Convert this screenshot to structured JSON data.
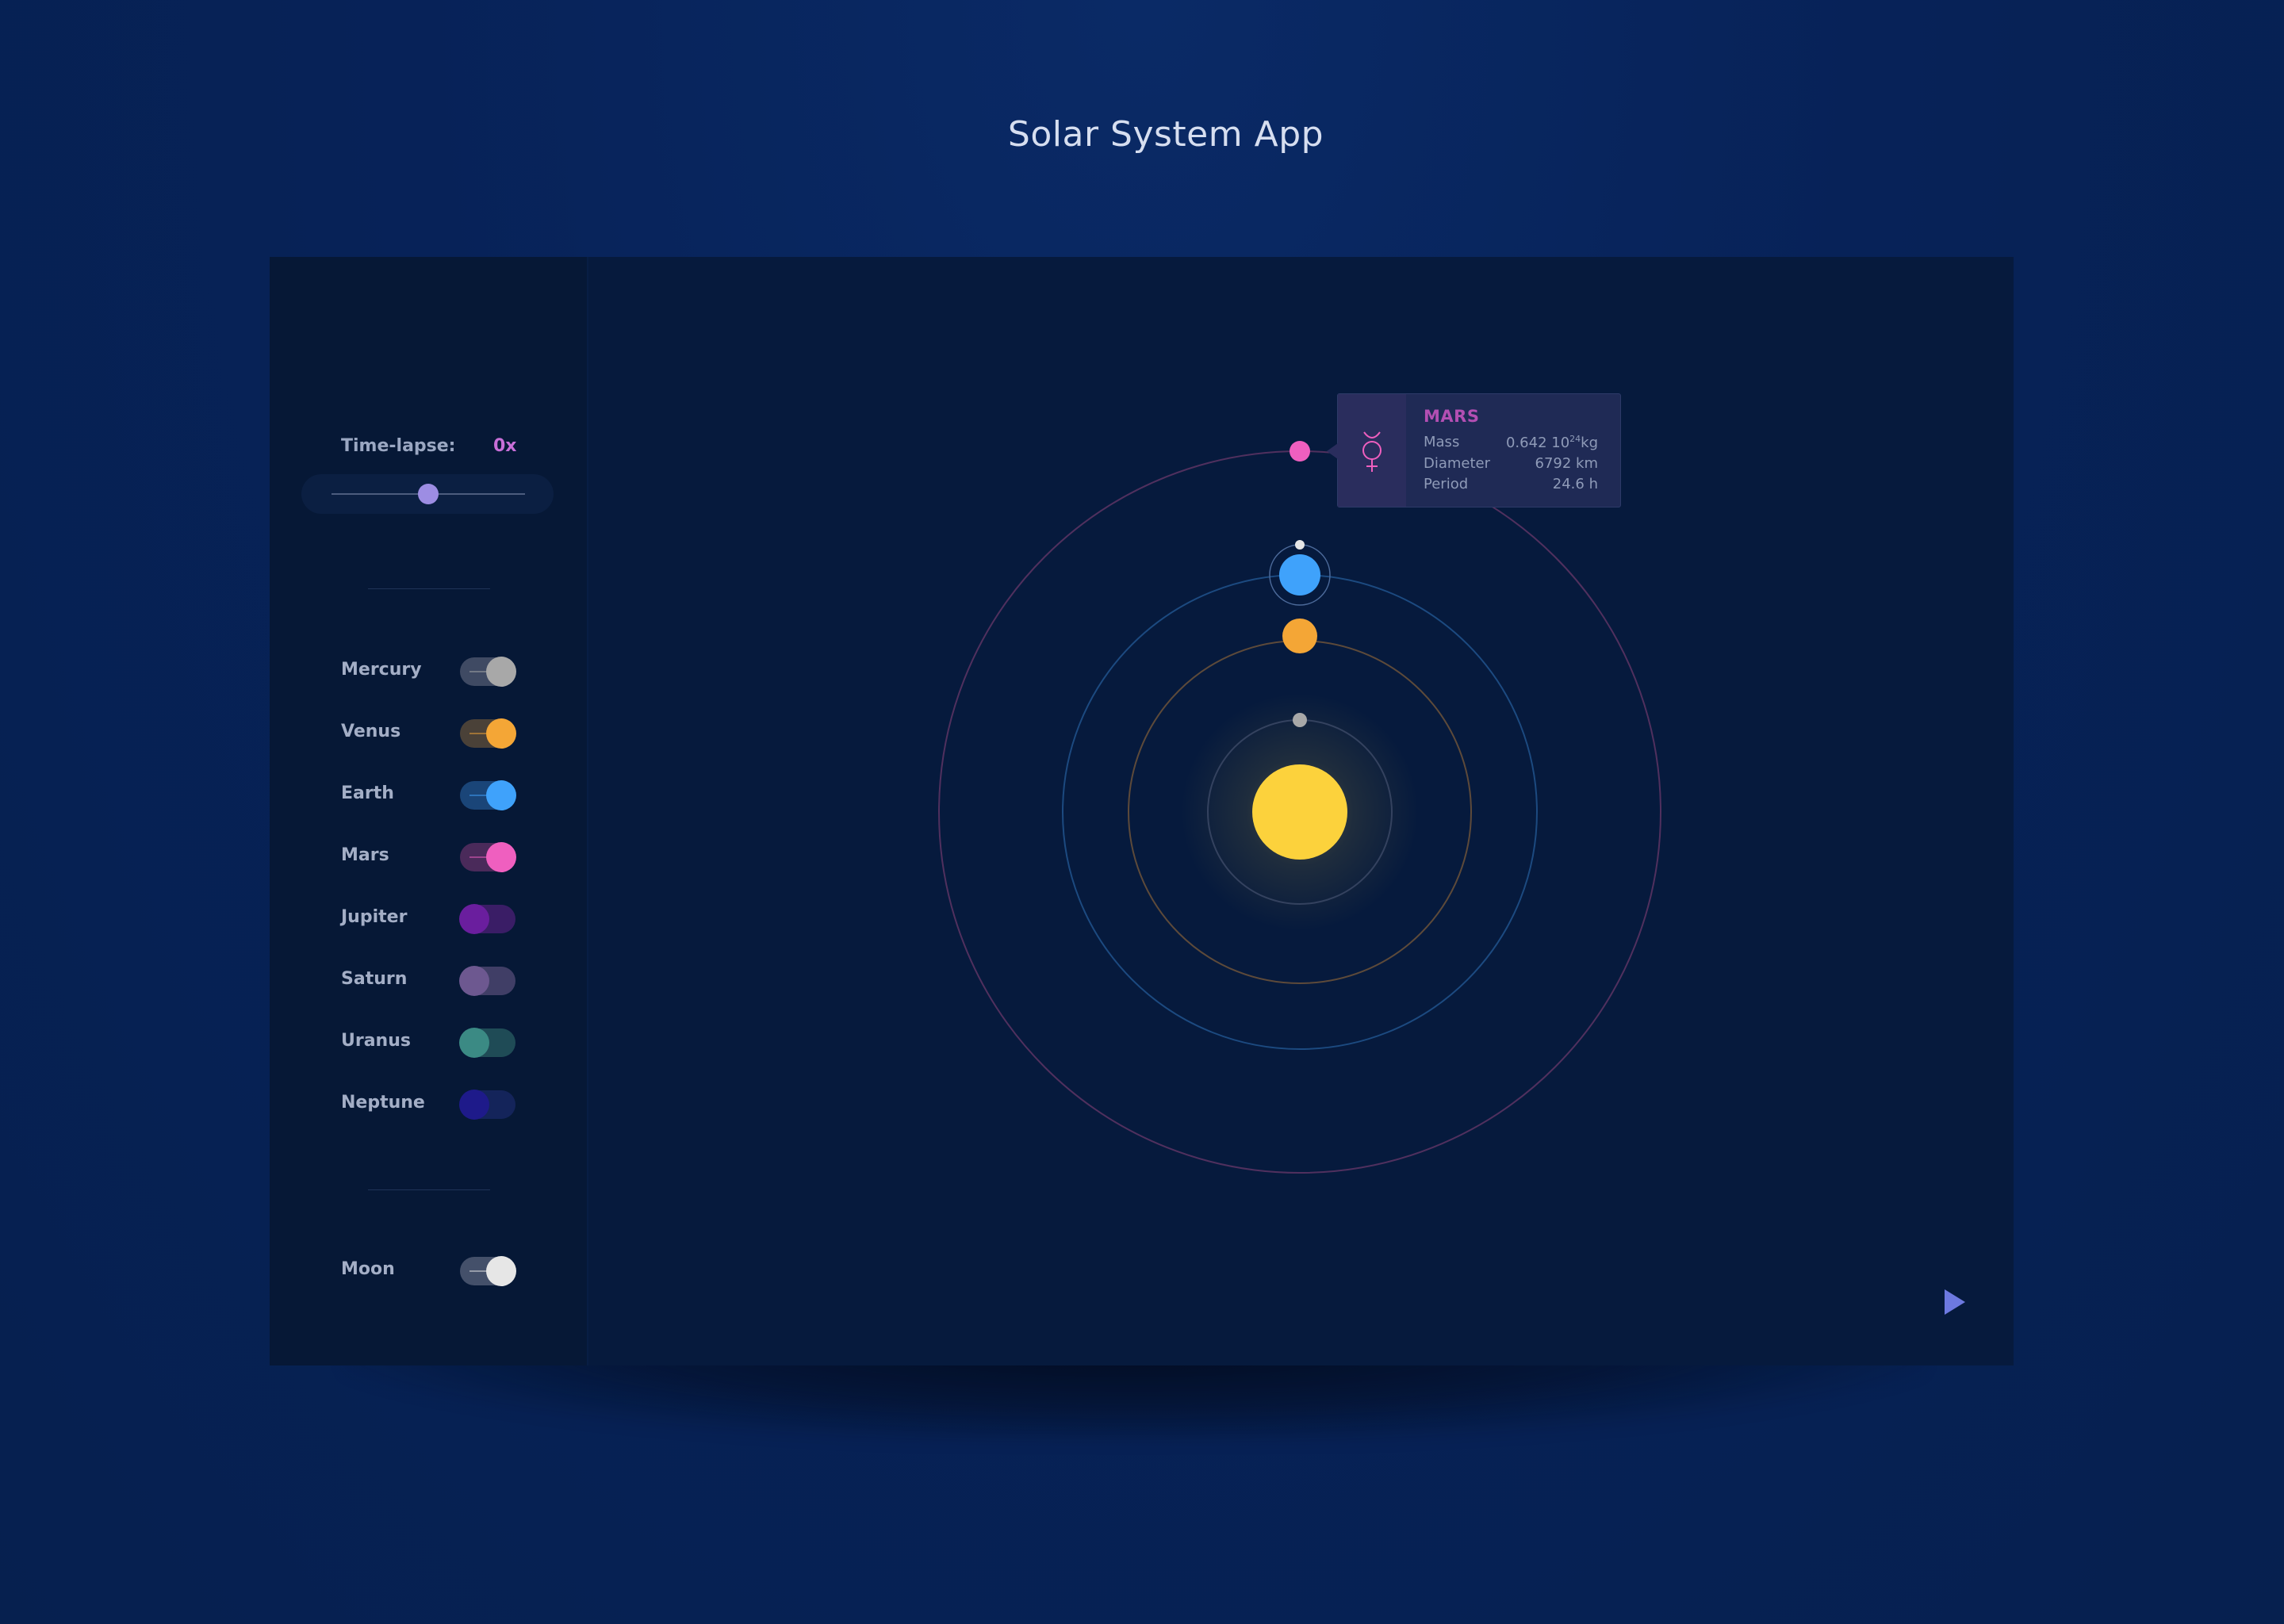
{
  "page": {
    "title": "Solar System App"
  },
  "sidebar": {
    "timelapse": {
      "label": "Time-lapse:",
      "value": "0x",
      "slider_fraction": 0.5
    },
    "planets": [
      {
        "label": "Mercury",
        "on": true,
        "knob": "#a8a8a8",
        "track": "#3f4a63"
      },
      {
        "label": "Venus",
        "on": true,
        "knob": "#f4a636",
        "track": "#4a4138"
      },
      {
        "label": "Earth",
        "on": true,
        "knob": "#3fa2fb",
        "track": "#1a4578"
      },
      {
        "label": "Mars",
        "on": true,
        "knob": "#ef5fbf",
        "track": "#4a2a5a"
      },
      {
        "label": "Jupiter",
        "on": false,
        "knob": "#6a1e9e",
        "track": "#3a1d66"
      },
      {
        "label": "Saturn",
        "on": false,
        "knob": "#6d5890",
        "track": "#403e66"
      },
      {
        "label": "Uranus",
        "on": false,
        "knob": "#3b8a84",
        "track": "#1f4b56"
      },
      {
        "label": "Neptune",
        "on": false,
        "knob": "#1e1a8a",
        "track": "#14245a"
      }
    ],
    "moon": {
      "label": "Moon",
      "on": true,
      "knob": "#e6e6e6",
      "track": "#44506a"
    }
  },
  "tooltip": {
    "title": "MARS",
    "icon": "mars-symbol-icon",
    "mass_label": "Mass",
    "mass_value": "0.642 10",
    "mass_exp": "24",
    "mass_unit": "kg",
    "diameter_label": "Diameter",
    "diameter_value": "6792 km",
    "period_label": "Period",
    "period_value": "24.6 h"
  },
  "colors": {
    "sun": "#fcd23c",
    "mercury": "#a8a8a8",
    "venus": "#f4a636",
    "earth": "#3fa2fb",
    "mars": "#ef5fbf",
    "moon": "#e6e6e6",
    "accent": "#9d8de3"
  },
  "controls": {
    "play_icon": "play-icon"
  }
}
